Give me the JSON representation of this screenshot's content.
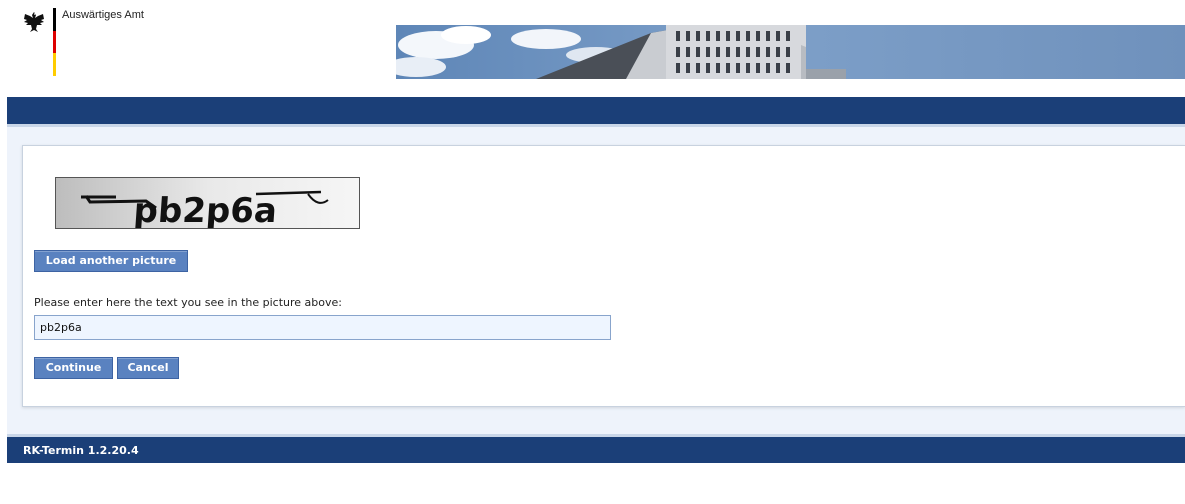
{
  "header": {
    "org_name": "Auswärtiges Amt",
    "logo_icon": "federal-eagle-icon",
    "flag_colors": [
      "#000000",
      "#dd0000",
      "#ffcc00"
    ]
  },
  "captcha": {
    "image_text": "pb2p6a",
    "reload_label": "Load another picture",
    "prompt": "Please enter here the text you see in the picture above:",
    "input_value": "pb2p6a"
  },
  "actions": {
    "continue_label": "Continue",
    "cancel_label": "Cancel"
  },
  "footer": {
    "version": "RK-Termin 1.2.20.4"
  },
  "colors": {
    "brand_blue": "#1b3f78",
    "button_blue": "#5a82c0"
  }
}
